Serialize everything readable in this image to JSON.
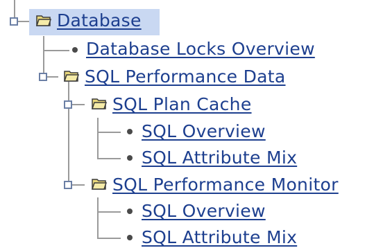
{
  "colors": {
    "link": "#1d3f8f",
    "selection_bg": "#c9d8f2",
    "tree_line": "#9a9a9a",
    "expander_border": "#6b7fa5",
    "folder_fill": "#e8d77a"
  },
  "icons": {
    "expander": "tree-expander-icon",
    "folder": "folder-open-icon",
    "leaf": "bullet-icon"
  },
  "tree": {
    "root": {
      "label": "Database",
      "selected": true,
      "children": [
        {
          "label": "Database Locks Overview"
        },
        {
          "label": "SQL Performance Data",
          "children": [
            {
              "label": "SQL Plan Cache",
              "children": [
                {
                  "label": "SQL Overview"
                },
                {
                  "label": "SQL Attribute Mix"
                }
              ]
            },
            {
              "label": "SQL Performance Monitor",
              "children": [
                {
                  "label": "SQL Overview"
                },
                {
                  "label": "SQL Attribute Mix"
                }
              ]
            }
          ]
        }
      ]
    }
  }
}
